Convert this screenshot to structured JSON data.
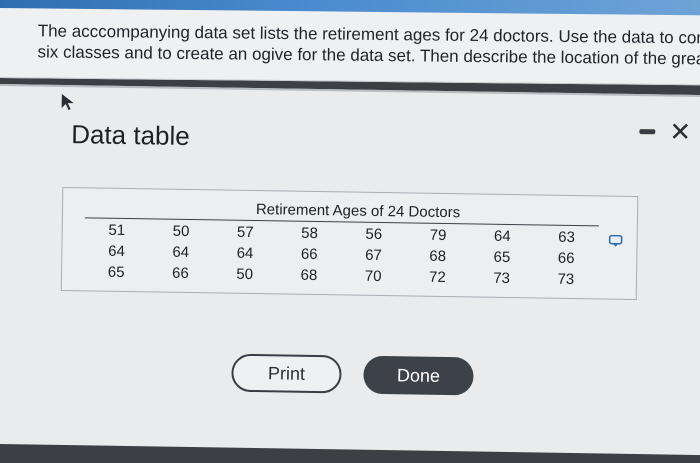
{
  "question": {
    "line1": "The acccompanying data set lists the retirement ages for 24 doctors. Use the data to construc",
    "line2": "six classes and to create an ogive for the data set. Then describe the location of the greatest i"
  },
  "dialog": {
    "title": "Data table",
    "close_label": "✕"
  },
  "table": {
    "title": "Retirement Ages of 24 Doctors",
    "rows": [
      [
        "51",
        "50",
        "57",
        "58",
        "56",
        "79",
        "64",
        "63"
      ],
      [
        "64",
        "64",
        "64",
        "66",
        "67",
        "68",
        "65",
        "66"
      ],
      [
        "65",
        "66",
        "50",
        "68",
        "70",
        "72",
        "73",
        "73"
      ]
    ]
  },
  "buttons": {
    "print_label": "Print",
    "done_label": "Done"
  },
  "colors": {
    "accent": "#3d4248",
    "top_bar": "#4a8ccf"
  }
}
